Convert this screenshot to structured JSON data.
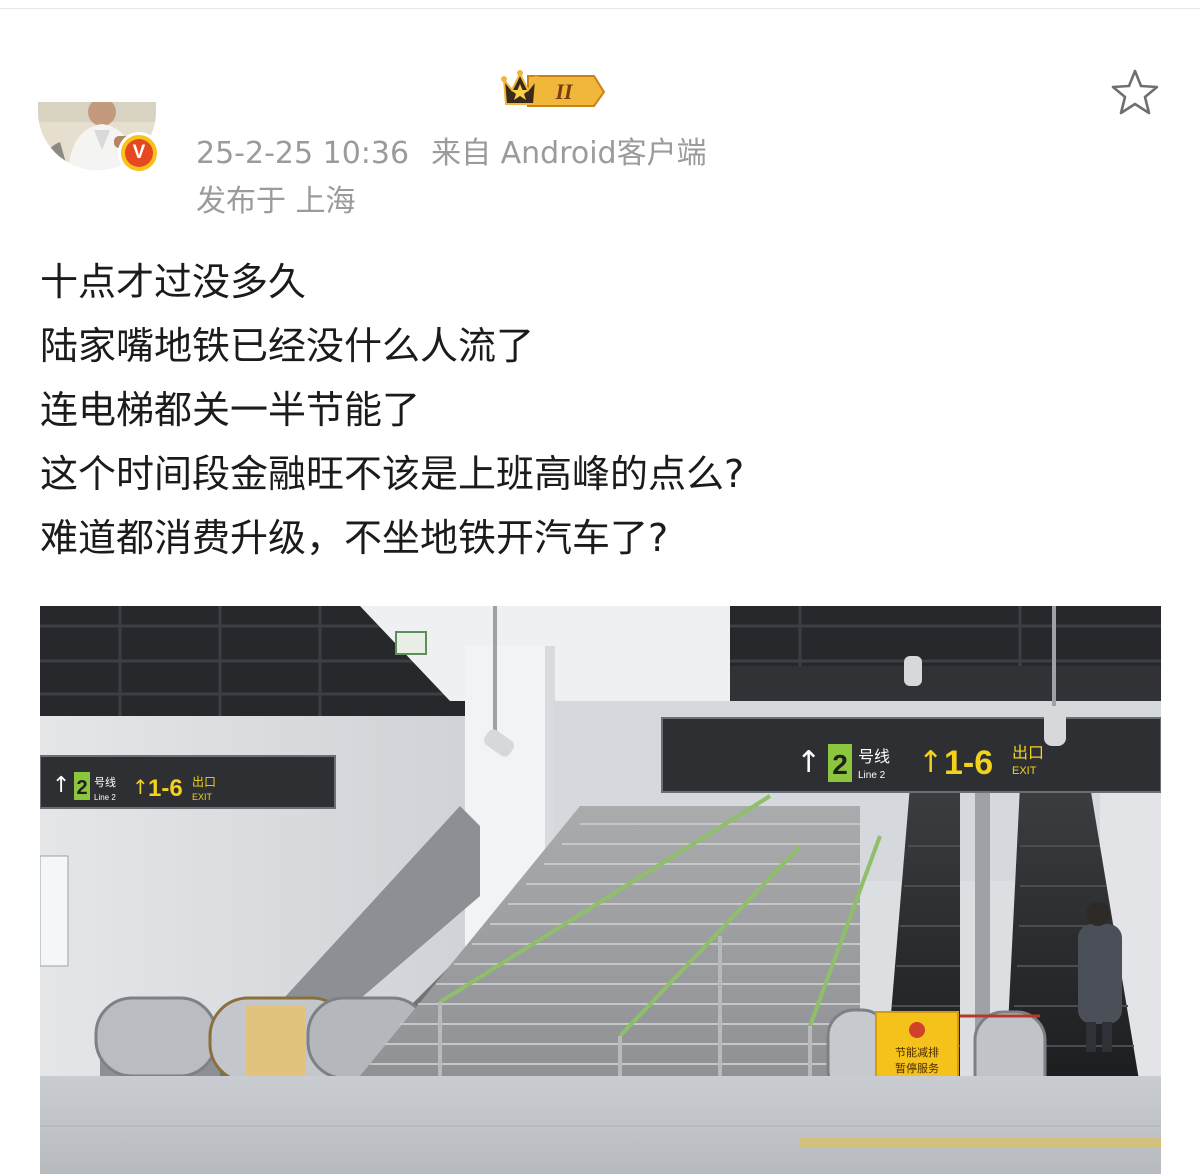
{
  "post": {
    "timestamp": "25-2-25 10:36",
    "source": "来自 Android客户端",
    "location": "发布于 上海",
    "badge_level": "II",
    "verified_mark": "V",
    "lines": [
      "十点才过没多久",
      "陆家嘴地铁已经没什么人流了",
      "连电梯都关一半节能了",
      "这个时间段金融旺不该是上班高峰的点么?",
      "难道都消费升级，不坐地铁开汽车了?"
    ]
  },
  "photo": {
    "sign_left": {
      "line_number": "2",
      "line_label": "号线",
      "line_en": "Line 2",
      "exit_range": "1-6",
      "exit_cn": "出口",
      "exit_en": "EXIT"
    },
    "sign_right": {
      "line_number": "2",
      "line_label": "号线",
      "line_en": "Line 2",
      "exit_range": "1-6",
      "exit_cn": "出口",
      "exit_en": "EXIT"
    },
    "notice": {
      "line1": "节能减排",
      "line2": "暂停服务"
    }
  },
  "icons": {
    "avatar": "avatar",
    "verified": "verified-badge-icon",
    "member": "crown-badge-icon",
    "favorite": "star-icon"
  },
  "colors": {
    "meta_text": "#9b9b9b",
    "body_text": "#1b1b1b",
    "verified_badge": "#f7c21a",
    "sign_yellow": "#f2d21b",
    "line2_green": "#8cc63f"
  }
}
